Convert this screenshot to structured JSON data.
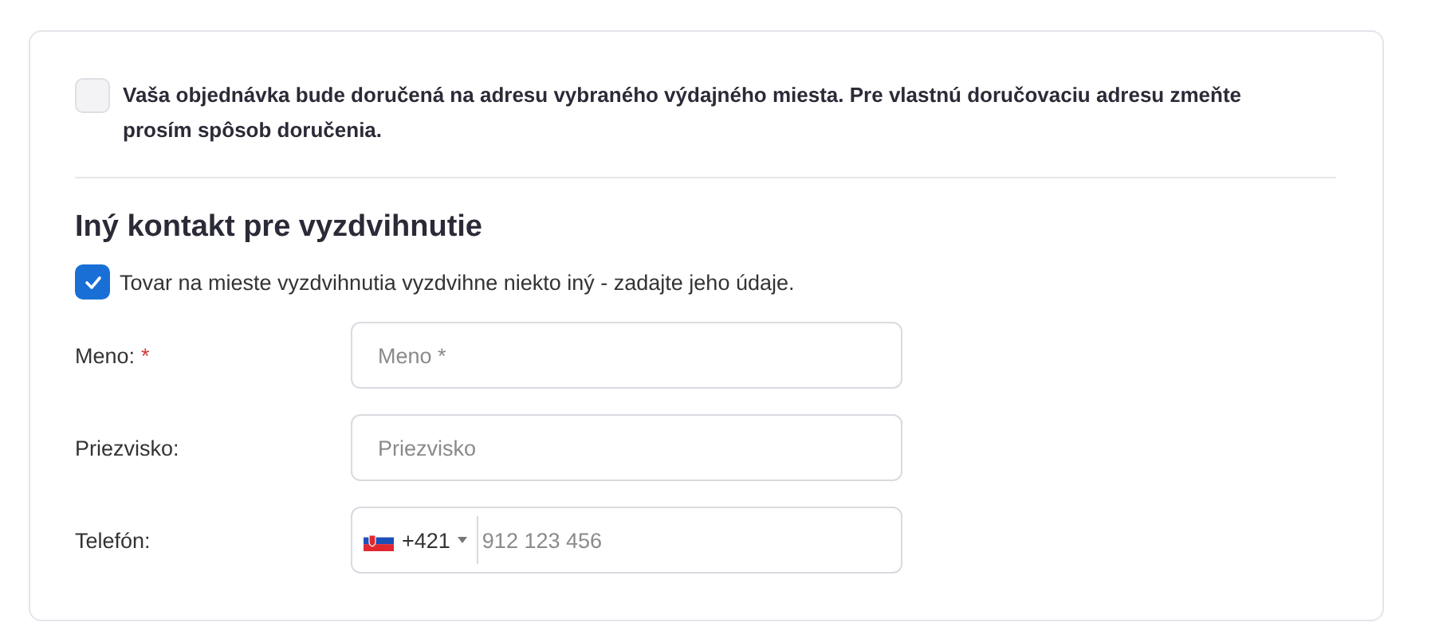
{
  "delivery_notice": {
    "checked": false,
    "text": "Vaša objednávka bude doručená na adresu vybraného výdajného miesta. Pre vlastnú doručovaciu adresu zmeňte prosím spôsob doručenia."
  },
  "section": {
    "title": "Iný kontakt pre vyzdvihnutie"
  },
  "other_person": {
    "checked": true,
    "text": "Tovar na mieste vyzdvihnutia vyzdvihne niekto iný - zadajte jeho údaje."
  },
  "fields": [
    {
      "kind": "text",
      "label": "Meno:",
      "required_mark": "*",
      "placeholder": "Meno *"
    },
    {
      "kind": "text",
      "label": "Priezvisko:",
      "placeholder": "Priezvisko"
    },
    {
      "kind": "phone",
      "label": "Telefón:",
      "dial_code": "+421",
      "placeholder": "912 123 456"
    }
  ]
}
